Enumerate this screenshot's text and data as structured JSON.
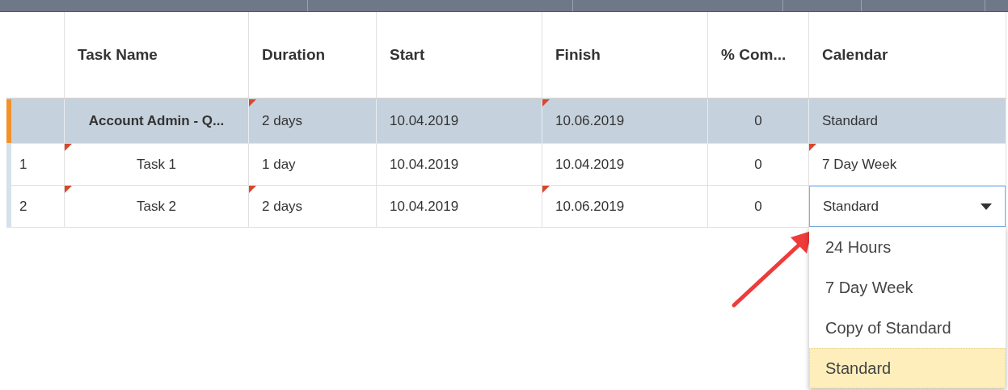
{
  "table": {
    "columns": [
      {
        "label": "Task Name"
      },
      {
        "label": "Duration"
      },
      {
        "label": "Start"
      },
      {
        "label": "Finish"
      },
      {
        "label": "% Com..."
      },
      {
        "label": "Calendar"
      }
    ],
    "rows": [
      {
        "summary": true,
        "number": "",
        "cells": [
          {
            "text": "Account Admin - Q...",
            "flagged": false,
            "kind": "text"
          },
          {
            "text": "2 days",
            "flagged": true,
            "kind": "text"
          },
          {
            "text": "10.04.2019",
            "flagged": false,
            "kind": "text"
          },
          {
            "text": "10.06.2019",
            "flagged": true,
            "kind": "text"
          },
          {
            "text": "0",
            "flagged": false,
            "kind": "text"
          },
          {
            "text": "Standard",
            "flagged": false,
            "kind": "text"
          }
        ]
      },
      {
        "summary": false,
        "number": "1",
        "cells": [
          {
            "text": "Task 1",
            "flagged": true,
            "kind": "text"
          },
          {
            "text": "1 day",
            "flagged": false,
            "kind": "text"
          },
          {
            "text": "10.04.2019",
            "flagged": false,
            "kind": "text"
          },
          {
            "text": "10.04.2019",
            "flagged": false,
            "kind": "text"
          },
          {
            "text": "0",
            "flagged": false,
            "kind": "text"
          },
          {
            "text": "7 Day Week",
            "flagged": true,
            "kind": "text"
          }
        ]
      },
      {
        "summary": false,
        "number": "2",
        "cells": [
          {
            "text": "Task 2",
            "flagged": true,
            "kind": "text"
          },
          {
            "text": "2 days",
            "flagged": true,
            "kind": "text"
          },
          {
            "text": "10.04.2019",
            "flagged": false,
            "kind": "text"
          },
          {
            "text": "10.06.2019",
            "flagged": true,
            "kind": "text"
          },
          {
            "text": "0",
            "flagged": false,
            "kind": "text"
          },
          {
            "text": "Standard",
            "flagged": false,
            "kind": "dropdown"
          }
        ]
      }
    ]
  },
  "dropdown": {
    "options": [
      {
        "label": "24 Hours",
        "selected": false
      },
      {
        "label": "7 Day Week",
        "selected": false
      },
      {
        "label": "Copy of Standard",
        "selected": false
      },
      {
        "label": "Standard",
        "selected": true
      }
    ]
  }
}
